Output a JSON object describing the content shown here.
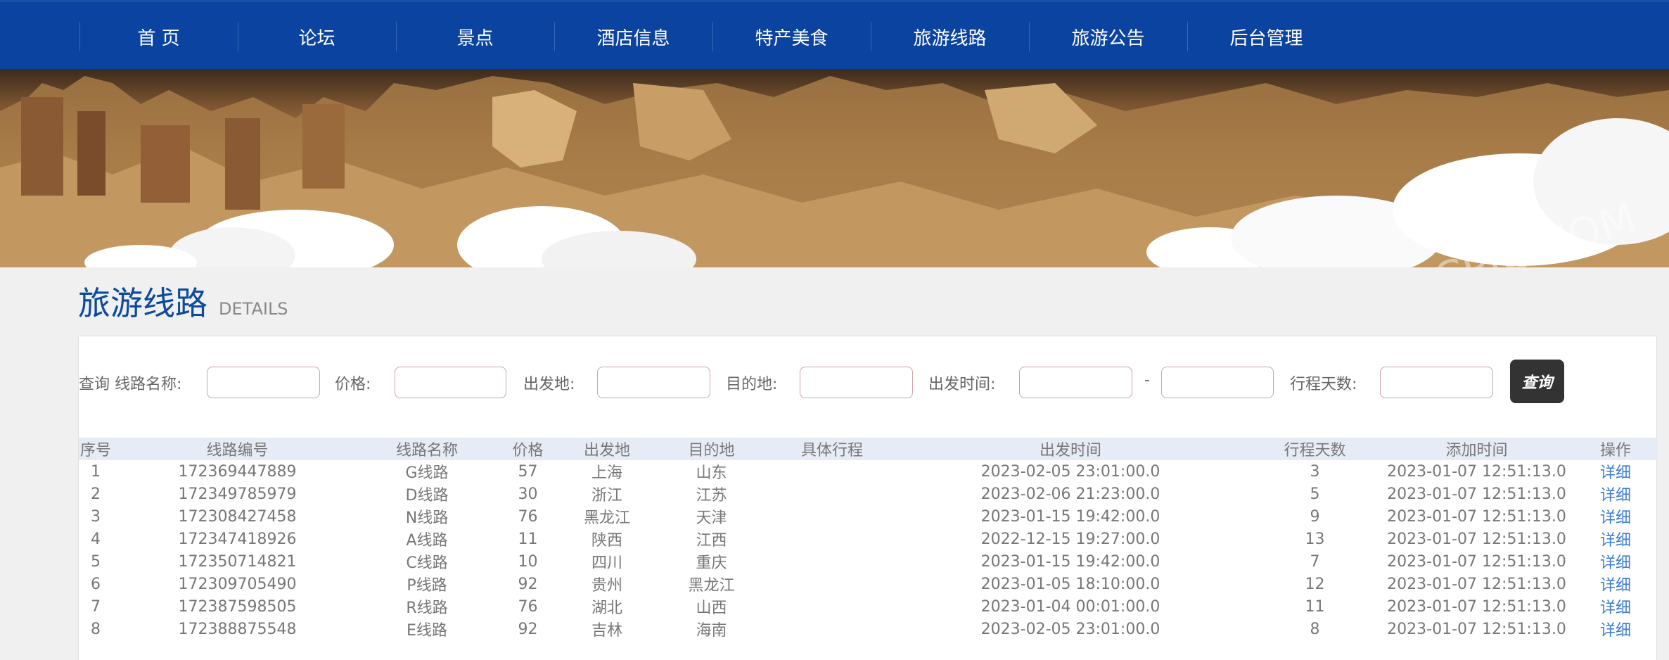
{
  "nav": {
    "items": [
      "首 页",
      "论坛",
      "景点",
      "酒店信息",
      "特产美食",
      "旅游线路",
      "旅游公告",
      "后台管理"
    ]
  },
  "banner": {
    "watermark": "CPIC.COM"
  },
  "section": {
    "title": "旅游线路",
    "subtitle": "DETAILS"
  },
  "search": {
    "query_label": "查询 线路名称:",
    "price_label": "价格:",
    "origin_label": "出发地:",
    "destination_label": "目的地:",
    "depart_time_label": "出发时间:",
    "range_sep": "-",
    "days_label": "行程天数:",
    "button_label": "查询"
  },
  "table": {
    "headers": [
      "序号",
      "线路编号",
      "线路名称",
      "价格",
      "出发地",
      "目的地",
      "具体行程",
      "出发时间",
      "行程天数",
      "添加时间",
      "操作"
    ],
    "rows": [
      [
        "1",
        "172369447889",
        "G线路",
        "57",
        "上海",
        "山东",
        "",
        "2023-02-05 23:01:00.0",
        "3",
        "2023-01-07 12:51:13.0",
        "详细"
      ],
      [
        "2",
        "172349785979",
        "D线路",
        "30",
        "浙江",
        "江苏",
        "",
        "2023-02-06 21:23:00.0",
        "5",
        "2023-01-07 12:51:13.0",
        "详细"
      ],
      [
        "3",
        "172308427458",
        "N线路",
        "76",
        "黑龙江",
        "天津",
        "",
        "2023-01-15 19:42:00.0",
        "9",
        "2023-01-07 12:51:13.0",
        "详细"
      ],
      [
        "4",
        "172347418926",
        "A线路",
        "11",
        "陕西",
        "江西",
        "",
        "2022-12-15 19:27:00.0",
        "13",
        "2023-01-07 12:51:13.0",
        "详细"
      ],
      [
        "5",
        "172350714821",
        "C线路",
        "10",
        "四川",
        "重庆",
        "",
        "2023-01-15 19:42:00.0",
        "7",
        "2023-01-07 12:51:13.0",
        "详细"
      ],
      [
        "6",
        "172309705490",
        "P线路",
        "92",
        "贵州",
        "黑龙江",
        "",
        "2023-01-05 18:10:00.0",
        "12",
        "2023-01-07 12:51:13.0",
        "详细"
      ],
      [
        "7",
        "172387598505",
        "R线路",
        "76",
        "湖北",
        "山西",
        "",
        "2023-01-04 00:01:00.0",
        "11",
        "2023-01-07 12:51:13.0",
        "详细"
      ],
      [
        "8",
        "172388875548",
        "E线路",
        "92",
        "吉林",
        "海南",
        "",
        "2023-02-05 23:01:00.0",
        "8",
        "2023-01-07 12:51:13.0",
        "详细"
      ]
    ]
  },
  "colors": {
    "nav_bg": "#0b43a0",
    "title": "#0b4aa0",
    "link": "#3a7bd5",
    "button_bg": "#333333"
  }
}
